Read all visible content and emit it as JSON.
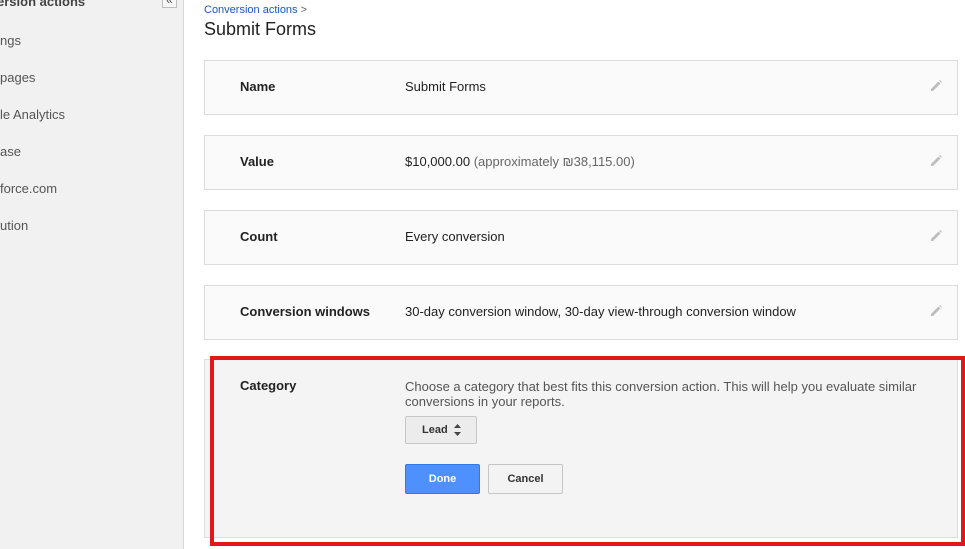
{
  "sidebar": {
    "title": "ersion actions",
    "collapse_glyph": "«",
    "items": [
      {
        "label": "ngs"
      },
      {
        "label": "pages"
      },
      {
        "label": "le Analytics"
      },
      {
        "label": "ase"
      },
      {
        "label": "force.com"
      },
      {
        "label": "ution"
      }
    ]
  },
  "breadcrumb": {
    "link": "Conversion actions",
    "separator": ">"
  },
  "page_title": "Submit Forms",
  "rows": {
    "name": {
      "label": "Name",
      "value": "Submit Forms"
    },
    "value": {
      "label": "Value",
      "value": "$10,000.00",
      "approx": "(approximately ₪38,115.00)"
    },
    "count": {
      "label": "Count",
      "value": "Every conversion"
    },
    "windows": {
      "label": "Conversion windows",
      "value": "30-day conversion window, 30-day view-through conversion window"
    }
  },
  "category": {
    "label": "Category",
    "description": "Choose a category that best fits this conversion action. This will help you evaluate similar conversions in your reports.",
    "selected": "Lead",
    "done_label": "Done",
    "cancel_label": "Cancel"
  },
  "colors": {
    "accent_blue": "#4d90fe",
    "link_blue": "#1a56c4",
    "highlight_red": "#e3161c"
  }
}
